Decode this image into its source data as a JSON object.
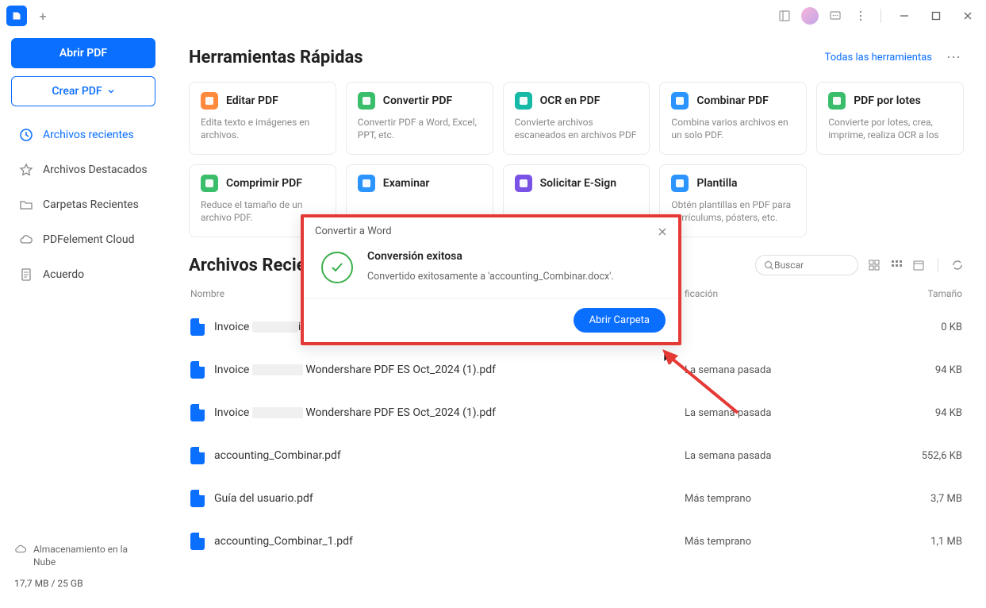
{
  "sidebar": {
    "open_pdf": "Abrir PDF",
    "create_pdf": "Crear PDF",
    "nav": [
      {
        "label": "Archivos recientes"
      },
      {
        "label": "Archivos Destacados"
      },
      {
        "label": "Carpetas Recientes"
      },
      {
        "label": "PDFelement Cloud"
      },
      {
        "label": "Acuerdo"
      }
    ],
    "storage_label": "Almacenamiento en la Nube",
    "quota": "17,7 MB / 25 GB"
  },
  "quick_tools": {
    "title": "Herramientas Rápidas",
    "all_link": "Todas las herramientas",
    "cards": [
      {
        "title": "Editar PDF",
        "desc": "Edita texto e imágenes en archivos.",
        "color": "#FF8A3D"
      },
      {
        "title": "Convertir PDF",
        "desc": "Convertir PDF a Word, Excel, PPT, etc.",
        "color": "#3BBE6C"
      },
      {
        "title": "OCR en PDF",
        "desc": "Convierte archivos escaneados en archivos PDF editables y q...",
        "color": "#17B9A7"
      },
      {
        "title": "Combinar PDF",
        "desc": "Combina varios archivos en un solo PDF.",
        "color": "#2C94FF"
      },
      {
        "title": "PDF por lotes",
        "desc": "Convierte por lotes, crea, imprime, realiza OCR a los PD...",
        "color": "#3BBE6C"
      },
      {
        "title": "Comprimir PDF",
        "desc": "Reduce el tamaño de un archivo PDF.",
        "color": "#3BBE6C"
      },
      {
        "title": "Examinar",
        "desc": "",
        "color": "#2C94FF"
      },
      {
        "title": "Solicitar E-Sign",
        "desc": "",
        "color": "#7A52E6"
      },
      {
        "title": "Plantilla",
        "desc": "Obtén plantillas en PDF para currículums, pósters, etc.",
        "color": "#2C94FF"
      }
    ]
  },
  "recent": {
    "title": "Archivos Recient",
    "search_placeholder": "Buscar",
    "columns": {
      "name": "Nombre",
      "mod": "ficación",
      "size": "Tamaño"
    },
    "files": [
      {
        "name_pre": "Invoice ",
        "name_mid_w": 58,
        "name_post": "itec",
        "mod": "",
        "size": "0 KB"
      },
      {
        "name_pre": "Invoice ",
        "name_mid_w": 64,
        "name_post": " Wondershare PDF ES Oct_2024 (1).pdf",
        "mod": "La semana pasada",
        "size": "94 KB"
      },
      {
        "name_pre": "Invoice ",
        "name_mid_w": 64,
        "name_post": " Wondershare PDF ES Oct_2024 (1).pdf",
        "mod": "La semana pasada",
        "size": "94 KB"
      },
      {
        "name_pre": "accounting_Combinar.pdf",
        "name_mid_w": 0,
        "name_post": "",
        "mod": "La semana pasada",
        "size": "552,6 KB"
      },
      {
        "name_pre": "Guía del usuario.pdf",
        "name_mid_w": 0,
        "name_post": "",
        "mod": "Más temprano",
        "size": "3,7 MB"
      },
      {
        "name_pre": "accounting_Combinar_1.pdf",
        "name_mid_w": 0,
        "name_post": "",
        "mod": "Más temprano",
        "size": "1,1 MB"
      }
    ]
  },
  "dialog": {
    "title": "Convertir a Word",
    "heading": "Conversión exitosa",
    "message": "Convertido exitosamente a 'accounting_Combinar.docx'.",
    "button": "Abrir Carpeta"
  }
}
